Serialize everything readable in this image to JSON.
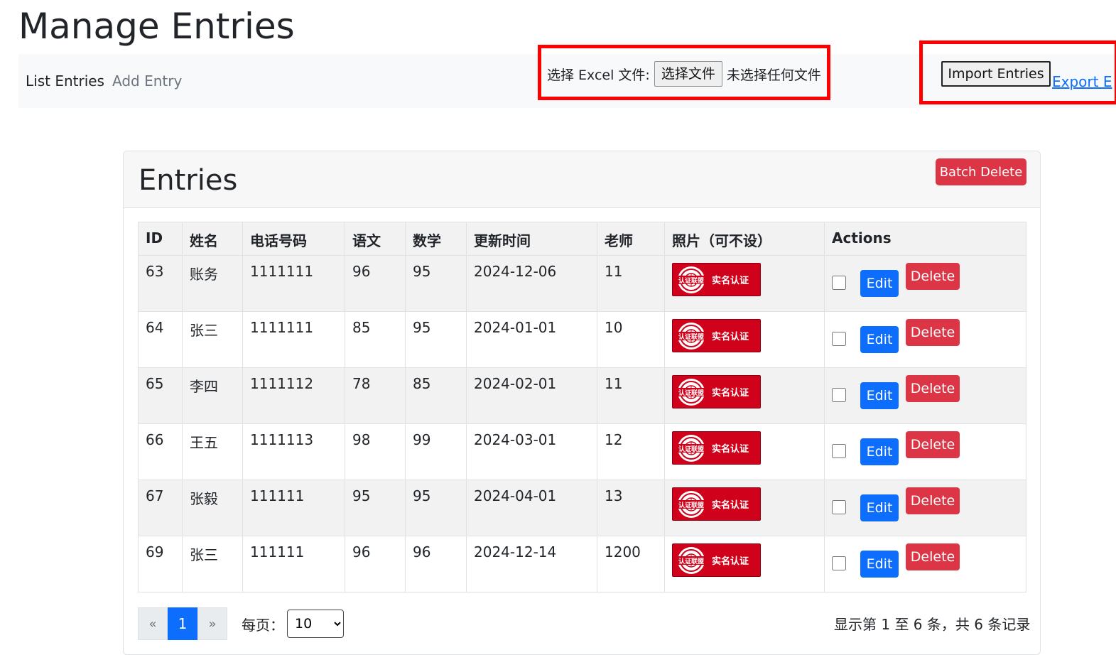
{
  "page": {
    "title": "Manage Entries"
  },
  "nav": {
    "list_label": "List Entries",
    "add_label": "Add Entry",
    "file_label": "选择 Excel 文件:",
    "file_button": "选择文件",
    "file_status": "未选择任何文件",
    "import_label": "Import Entries",
    "export_label": "Export E"
  },
  "card": {
    "title": "Entries",
    "batch_delete_label": "Batch Delete"
  },
  "table": {
    "headers": [
      "ID",
      "姓名",
      "电话号码",
      "语文",
      "数学",
      "更新时间",
      "老师",
      "照片（可不设）",
      "Actions"
    ],
    "badge_text": "实名认证",
    "badge_seal_text": "认证联盟",
    "edit_label": "Edit",
    "delete_label": "Delete",
    "rows": [
      {
        "id": "63",
        "name": "账务",
        "phone": "1111111",
        "chinese": "96",
        "math": "95",
        "updated": "2024-12-06",
        "teacher": "11"
      },
      {
        "id": "64",
        "name": "张三",
        "phone": "1111111",
        "chinese": "85",
        "math": "95",
        "updated": "2024-01-01",
        "teacher": "10"
      },
      {
        "id": "65",
        "name": "李四",
        "phone": "1111112",
        "chinese": "78",
        "math": "85",
        "updated": "2024-02-01",
        "teacher": "11"
      },
      {
        "id": "66",
        "name": "王五",
        "phone": "1111113",
        "chinese": "98",
        "math": "99",
        "updated": "2024-03-01",
        "teacher": "12"
      },
      {
        "id": "67",
        "name": "张毅",
        "phone": "111111",
        "chinese": "95",
        "math": "95",
        "updated": "2024-04-01",
        "teacher": "13"
      },
      {
        "id": "69",
        "name": "张三",
        "phone": "111111",
        "chinese": "96",
        "math": "96",
        "updated": "2024-12-14",
        "teacher": "1200"
      }
    ]
  },
  "pagination": {
    "prev": "«",
    "current": "1",
    "next": "»",
    "per_page_label": "每页：",
    "per_page_value": "10",
    "summary": "显示第 1 至 6 条，共 6 条记录"
  },
  "colors": {
    "primary": "#0d6efd",
    "danger": "#dc3545",
    "highlight_box": "#ff0000",
    "badge_red": "#d0021b"
  }
}
